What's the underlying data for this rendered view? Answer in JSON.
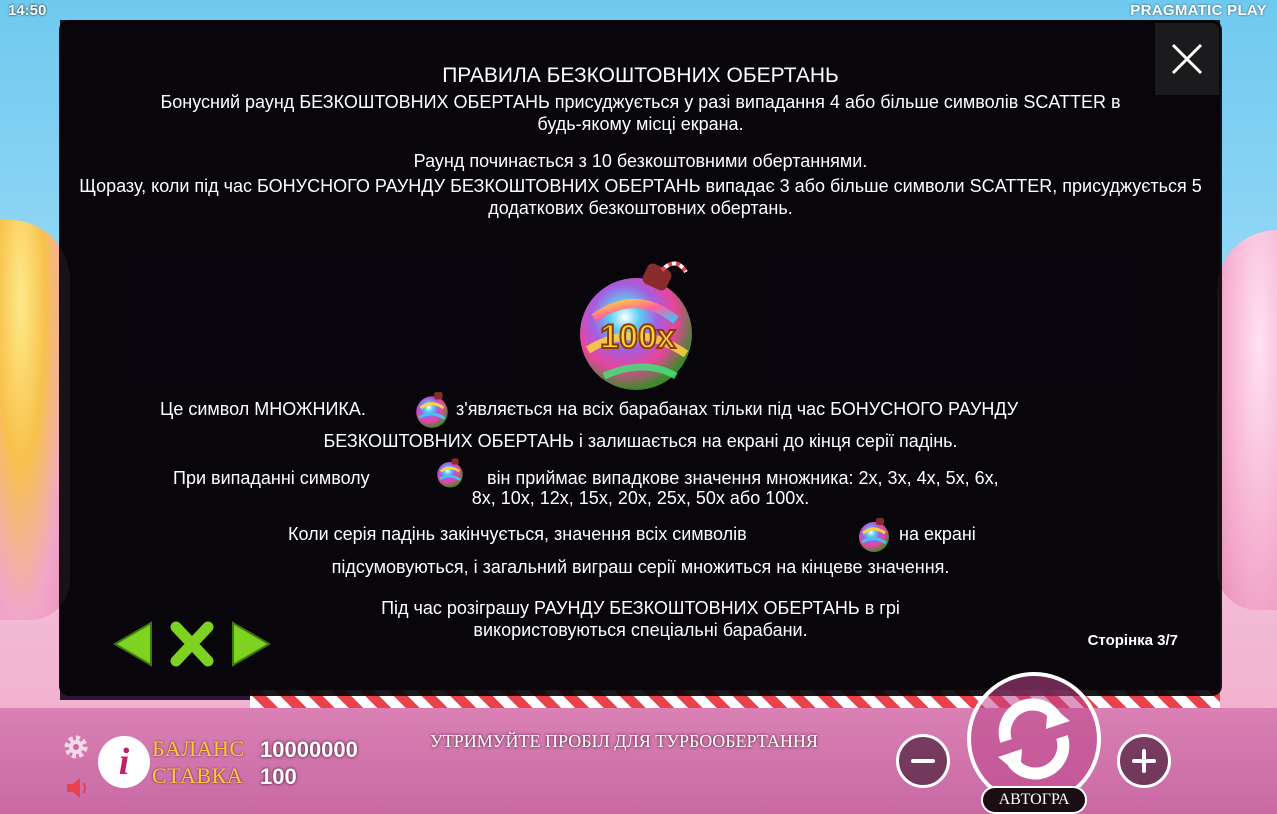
{
  "status_bar": {
    "time": "14:50",
    "brand": "PRAGMATIC PLAY"
  },
  "rules_modal": {
    "title": "ПРАВИЛА БЕЗКОШТОВНИХ ОБЕРТАНЬ",
    "paragraph_1": "Бонусний раунд БЕЗКОШТОВНИХ ОБЕРТАНЬ присуджується у разі випадання 4 або більше символів SCATTER в будь-якому місці екрана.",
    "paragraph_2_line_1": "Раунд починається з 10 безкоштовними обертаннями.",
    "paragraph_2_line_2": "Щоразу, коли під час БОНУСНОГО РАУНДУ БЕЗКОШТОВНИХ ОБЕРТАНЬ випадає 3 або більше символи SCATTER, присуджується 5 додаткових безкоштовних обертань.",
    "multiplier_symbol_value": "100x",
    "multiplier_line_1_before": "Це символ МНОЖНИКА.",
    "multiplier_line_1_after": "з'являється на всіх барабанах тільки під час БОНУСНОГО РАУНДУ",
    "multiplier_line_2": "БЕЗКОШТОВНИХ ОБЕРТАНЬ і залишається на екрані до кінця серії падінь.",
    "drop_line_1_before": "При випаданні символу",
    "drop_line_1_after": "він приймає випадкове значення множника: 2x, 3x, 4x, 5x, 6x,",
    "drop_line_2": "8x, 10x, 12x, 15x, 20x, 25x, 50x або 100x.",
    "end_line_1_before": "Коли серія падінь закінчується, значення всіх символів",
    "end_line_1_after": "на екрані",
    "end_line_2": "підсумовуються, і загальний виграш серії множиться на кінцеве значення.",
    "special_reels": "Під час розіграшу РАУНДУ БЕЗКОШТОВНИХ ОБЕРТАНЬ в грі використовуються спеціальні барабани.",
    "page_indicator": "Сторінка 3/7",
    "close_icon": "close-icon",
    "nav_icons": [
      "arrow-left-icon",
      "close-x-icon",
      "arrow-right-icon"
    ]
  },
  "bottom_bar": {
    "balance_label": "БАЛАНС",
    "balance_value": "10000000",
    "bet_label": "СТАВКА",
    "bet_value": "100",
    "turbo_hint": "УТРИМУЙТЕ ПРОБІЛ ДЛЯ ТУРБООБЕРТАННЯ",
    "autoplay_label": "АВТОГРА",
    "info_label": "i",
    "icons": [
      "gear-icon",
      "sound-icon",
      "minus-icon",
      "spin-icon",
      "plus-icon"
    ]
  },
  "colors": {
    "label_gold": "#ffc83d",
    "nav_green": "#7ed321",
    "modal_bg": "#050508"
  }
}
